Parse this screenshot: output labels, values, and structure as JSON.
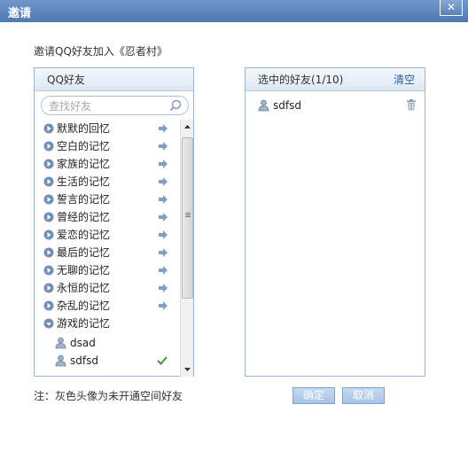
{
  "dialog": {
    "title": "邀请",
    "close_label": "✕",
    "subtitle": "邀请QQ好友加入《忍者村》"
  },
  "left_panel": {
    "header": "QQ好友",
    "search_placeholder": "查找好友",
    "groups": [
      {
        "label": "默默的回忆",
        "expanded": false
      },
      {
        "label": "空白的记忆",
        "expanded": false
      },
      {
        "label": "家族的记忆",
        "expanded": false
      },
      {
        "label": "生活的记忆",
        "expanded": false
      },
      {
        "label": "誓言的记忆",
        "expanded": false
      },
      {
        "label": "曾经的记忆",
        "expanded": false
      },
      {
        "label": "爱恋的记忆",
        "expanded": false
      },
      {
        "label": "最后的记忆",
        "expanded": false
      },
      {
        "label": "无聊的记忆",
        "expanded": false
      },
      {
        "label": "永恒的记忆",
        "expanded": false
      },
      {
        "label": "杂乱的记忆",
        "expanded": false
      },
      {
        "label": "游戏的记忆",
        "expanded": true
      }
    ],
    "friends": [
      {
        "name": "dsad",
        "selected": false
      },
      {
        "name": "sdfsd",
        "selected": true
      }
    ]
  },
  "right_panel": {
    "header": "选中的好友(1/10)",
    "clear_label": "清空",
    "selected": [
      {
        "name": "sdfsd"
      }
    ]
  },
  "footer": {
    "note": "注：灰色头像为未开通空间好友",
    "ok_label": "确定",
    "cancel_label": "取消"
  },
  "colors": {
    "accent": "#4f7ab2",
    "check": "#3a9a2e",
    "arrow": "#7fa0c4",
    "group_icon": "#6f8fb5"
  }
}
